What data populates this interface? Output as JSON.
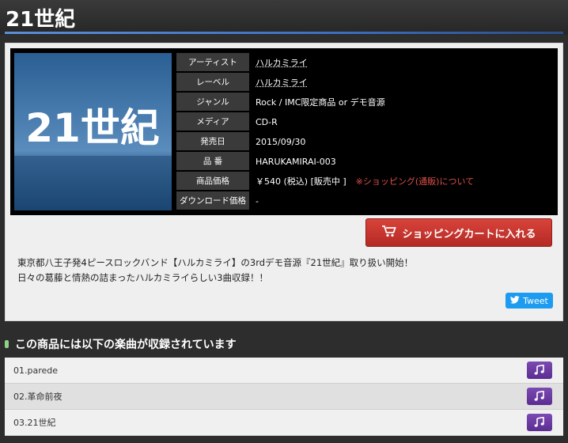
{
  "page": {
    "title": "21世紀"
  },
  "product": {
    "jacket_text": "21世紀",
    "specs": [
      {
        "label": "アーティスト",
        "value": "ハルカミライ"
      },
      {
        "label": "レーベル",
        "value": "ハルカミライ"
      },
      {
        "label": "ジャンル",
        "value": "Rock / IMC限定商品 or デモ音源"
      },
      {
        "label": "メディア",
        "value": "CD-R"
      },
      {
        "label": "発売日",
        "value": "2015/09/30"
      },
      {
        "label": "品 番",
        "value": "HARUKAMIRAI-003"
      },
      {
        "label": "商品価格",
        "value": "￥540 (税込) [販売中 ]",
        "link": "※ショッピング(通販)について"
      },
      {
        "label": "ダウンロード価格",
        "value": "-"
      }
    ],
    "cart_button": "ショッピングカートに入れる",
    "description": [
      "東京都八王子発4ピースロックバンド【ハルカミライ】の3rdデモ音源『21世紀』取り扱い開始！",
      "日々の葛藤と情熱の詰まったハルカミライらしい3曲収録！！"
    ],
    "tweet_label": "Tweet"
  },
  "tracks": {
    "heading": "この商品には以下の楽曲が収録されています",
    "items": [
      "01.parede",
      "02.革命前夜",
      "03.21世紀"
    ]
  },
  "colors": {
    "cart": "#c0302a",
    "music_button": "#6a3aa2",
    "tweet": "#1d9bf0",
    "link_red": "#e0514a"
  }
}
